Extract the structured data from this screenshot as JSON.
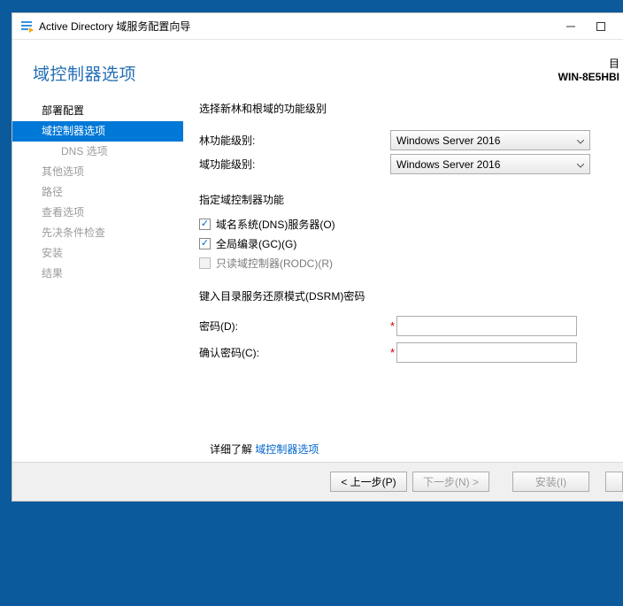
{
  "window": {
    "title": "Active Directory 域服务配置向导"
  },
  "header": {
    "page_title": "域控制器选项",
    "target_label": "目",
    "target_server": "WIN-8E5HBI"
  },
  "sidebar": {
    "items": [
      {
        "label": "部署配置",
        "state": "normal"
      },
      {
        "label": "域控制器选项",
        "state": "selected"
      },
      {
        "label": "DNS 选项",
        "state": "sub"
      },
      {
        "label": "其他选项",
        "state": "disabled"
      },
      {
        "label": "路径",
        "state": "disabled"
      },
      {
        "label": "查看选项",
        "state": "disabled"
      },
      {
        "label": "先决条件检查",
        "state": "disabled"
      },
      {
        "label": "安装",
        "state": "disabled"
      },
      {
        "label": "结果",
        "state": "disabled"
      }
    ]
  },
  "content": {
    "func_level_title": "选择新林和根域的功能级别",
    "forest_level_label": "林功能级别:",
    "forest_level_value": "Windows Server 2016",
    "domain_level_label": "域功能级别:",
    "domain_level_value": "Windows Server 2016",
    "dc_caps_title": "指定域控制器功能",
    "chk_dns_label": "域名系统(DNS)服务器(O)",
    "chk_gc_label": "全局编录(GC)(G)",
    "chk_rodc_label": "只读域控制器(RODC)(R)",
    "dsrm_title": "键入目录服务还原模式(DSRM)密码",
    "pwd_label": "密码(D):",
    "pwd_confirm_label": "确认密码(C):",
    "more_prefix": "详细了解",
    "more_link": "域控制器选项"
  },
  "footer": {
    "prev": "< 上一步(P)",
    "next": "下一步(N) >",
    "install": "安装(I)"
  }
}
